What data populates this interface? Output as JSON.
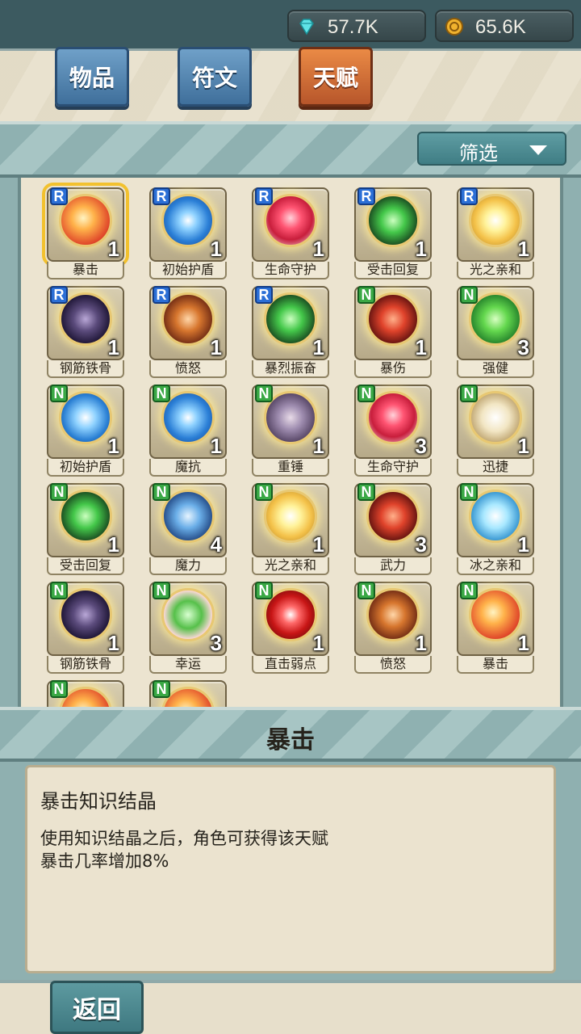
{
  "resources": {
    "gems": "57.7K",
    "gold": "65.6K"
  },
  "tabs": [
    "物品",
    "符文",
    "天赋"
  ],
  "active_tab": "天赋",
  "filter": {
    "label": "筛选"
  },
  "items": [
    {
      "rarity": "R",
      "name": "暴击",
      "count": "1",
      "icon": "fire-burst-icon",
      "theme": "fire",
      "selected": true
    },
    {
      "rarity": "R",
      "name": "初始护盾",
      "count": "1",
      "icon": "water-swirl-icon",
      "theme": "water"
    },
    {
      "rarity": "R",
      "name": "生命守护",
      "count": "1",
      "icon": "heart-shield-icon",
      "theme": "heart"
    },
    {
      "rarity": "R",
      "name": "受击回复",
      "count": "1",
      "icon": "green-recovery-icon",
      "theme": "green"
    },
    {
      "rarity": "R",
      "name": "光之亲和",
      "count": "1",
      "icon": "light-affinity-icon",
      "theme": "light"
    },
    {
      "rarity": "R",
      "name": "钢筋铁骨",
      "count": "1",
      "icon": "dark-armor-icon",
      "theme": "dark"
    },
    {
      "rarity": "R",
      "name": "愤怒",
      "count": "1",
      "icon": "rage-warrior-icon",
      "theme": "orange"
    },
    {
      "rarity": "R",
      "name": "暴烈振奋",
      "count": "1",
      "icon": "green-frenzy-icon",
      "theme": "green"
    },
    {
      "rarity": "N",
      "name": "暴伤",
      "count": "1",
      "icon": "critical-damage-icon",
      "theme": "war"
    },
    {
      "rarity": "N",
      "name": "强健",
      "count": "3",
      "icon": "green-fist-icon",
      "theme": "fist"
    },
    {
      "rarity": "N",
      "name": "初始护盾",
      "count": "1",
      "icon": "water-swirl-icon",
      "theme": "shield"
    },
    {
      "rarity": "N",
      "name": "魔抗",
      "count": "1",
      "icon": "magic-resist-icon",
      "theme": "water"
    },
    {
      "rarity": "N",
      "name": "重锤",
      "count": "1",
      "icon": "hammer-icon",
      "theme": "hammer"
    },
    {
      "rarity": "N",
      "name": "生命守护",
      "count": "3",
      "icon": "heart-shield-icon",
      "theme": "heart"
    },
    {
      "rarity": "N",
      "name": "迅捷",
      "count": "1",
      "icon": "swift-sword-icon",
      "theme": "sword"
    },
    {
      "rarity": "N",
      "name": "受击回复",
      "count": "1",
      "icon": "green-recovery-icon",
      "theme": "green"
    },
    {
      "rarity": "N",
      "name": "魔力",
      "count": "4",
      "icon": "spell-book-icon",
      "theme": "book"
    },
    {
      "rarity": "N",
      "name": "光之亲和",
      "count": "1",
      "icon": "light-affinity-icon",
      "theme": "light"
    },
    {
      "rarity": "N",
      "name": "武力",
      "count": "3",
      "icon": "force-warrior-icon",
      "theme": "war"
    },
    {
      "rarity": "N",
      "name": "冰之亲和",
      "count": "1",
      "icon": "ice-affinity-icon",
      "theme": "ice"
    },
    {
      "rarity": "N",
      "name": "钢筋铁骨",
      "count": "1",
      "icon": "dark-armor-icon",
      "theme": "dark"
    },
    {
      "rarity": "N",
      "name": "幸运",
      "count": "3",
      "icon": "clover-icon",
      "theme": "clover"
    },
    {
      "rarity": "N",
      "name": "直击弱点",
      "count": "1",
      "icon": "target-icon",
      "theme": "target"
    },
    {
      "rarity": "N",
      "name": "愤怒",
      "count": "1",
      "icon": "rage-warrior-icon",
      "theme": "orange"
    },
    {
      "rarity": "N",
      "name": "暴击",
      "count": "1",
      "icon": "fire-burst-icon",
      "theme": "fire"
    },
    {
      "rarity": "N",
      "name": "",
      "count": "",
      "icon": "partial-orb-icon",
      "theme": "fire"
    },
    {
      "rarity": "N",
      "name": "",
      "count": "",
      "icon": "partial-orb-icon",
      "theme": "fire"
    }
  ],
  "detail": {
    "title": "暴击",
    "subtitle": "暴击知识结晶",
    "line1": "使用知识结晶之后，角色可获得该天赋",
    "line2": "暴击几率增加8%"
  },
  "back_label": "返回"
}
